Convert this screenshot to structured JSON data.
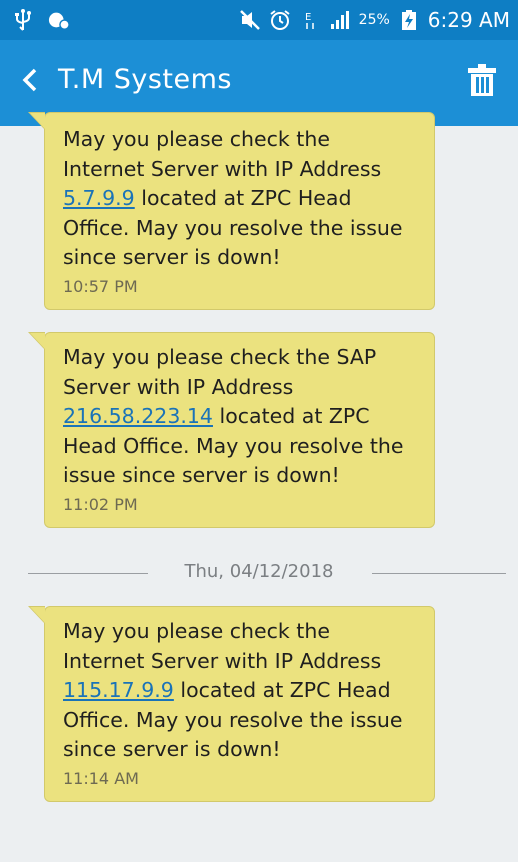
{
  "status_bar": {
    "battery_percent": "25%",
    "time": "6:29 AM",
    "icons": [
      "usb-icon",
      "notification-icon",
      "mute-icon",
      "alarm-icon",
      "data-icon",
      "signal-icon",
      "battery-charging-icon"
    ]
  },
  "header": {
    "title": "T.M Systems",
    "background": "#1c8fd6",
    "statusbar_background": "#0e7ec4"
  },
  "messages": [
    {
      "pre": "May you please check the Internet Server  with IP Address ",
      "ip": "5.7.9.9",
      "post": " located at ZPC Head Office. May you resolve the issue since server is down!",
      "time": "10:57 PM"
    },
    {
      "pre": "May you please check the SAP Server  with IP Address ",
      "ip": "216.58.223.14",
      "post": " located at ZPC Head Office. May you resolve the issue since server is down!",
      "time": "11:02 PM"
    },
    {
      "pre": "May you please check the Internet Server  with IP Address ",
      "ip": "115.17.9.9",
      "post": " located at ZPC Head Office. May you resolve the issue since server is down!",
      "time": "11:14 AM"
    }
  ],
  "date_divider": "Thu, 04/12/2018",
  "colors": {
    "bubble": "#ebe27f",
    "link": "#1a73b8",
    "background": "#eceff1"
  }
}
